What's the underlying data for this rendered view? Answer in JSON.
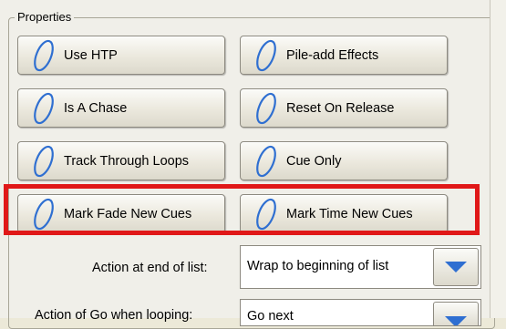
{
  "group": {
    "title": "Properties"
  },
  "buttons": [
    {
      "label": "Use HTP"
    },
    {
      "label": "Pile-add Effects"
    },
    {
      "label": "Is A Chase"
    },
    {
      "label": "Reset On Release"
    },
    {
      "label": "Track Through Loops"
    },
    {
      "label": "Cue Only"
    },
    {
      "label": "Mark Fade New Cues"
    },
    {
      "label": "Mark Time New Cues"
    }
  ],
  "fields": {
    "end_of_list": {
      "label": "Action at end of list:",
      "value": "Wrap to beginning of list"
    },
    "go_when_looping": {
      "label": "Action of Go when looping:",
      "value": "Go next"
    }
  },
  "icons": {
    "toggle": "toggle-ellipse-icon",
    "dropdown": "chevron-down-icon"
  },
  "colors": {
    "accent": "#2f6fd1",
    "highlight": "#e01818"
  }
}
